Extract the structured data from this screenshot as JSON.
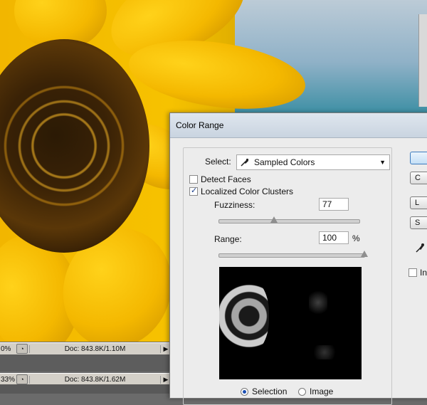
{
  "status_top": {
    "zoom": "0%",
    "doc": "Doc: 843.8K/1.10M"
  },
  "status_bottom": {
    "zoom": "33%",
    "doc": "Doc: 843.8K/1.62M"
  },
  "dialog": {
    "title": "Color Range",
    "select_label": "Select:",
    "select_value": "Sampled Colors",
    "detect_faces": {
      "label": "Detect Faces",
      "checked": false
    },
    "localized": {
      "label": "Localized Color Clusters",
      "checked": true
    },
    "fuzziness": {
      "label": "Fuzziness:",
      "value": "77",
      "fraction": 0.39
    },
    "range": {
      "label": "Range:",
      "value": "100",
      "unit": "%",
      "fraction": 1.0
    },
    "radio_selection": "Selection",
    "radio_image": "Image",
    "selected_radio": "Selection",
    "buttons": {
      "ok": "",
      "cancel": "C",
      "load": "L",
      "save": "S"
    },
    "invert_label": "In"
  },
  "colors": {
    "accent_button": "#3d7bbd",
    "radio_on": "#1b4fb3"
  }
}
